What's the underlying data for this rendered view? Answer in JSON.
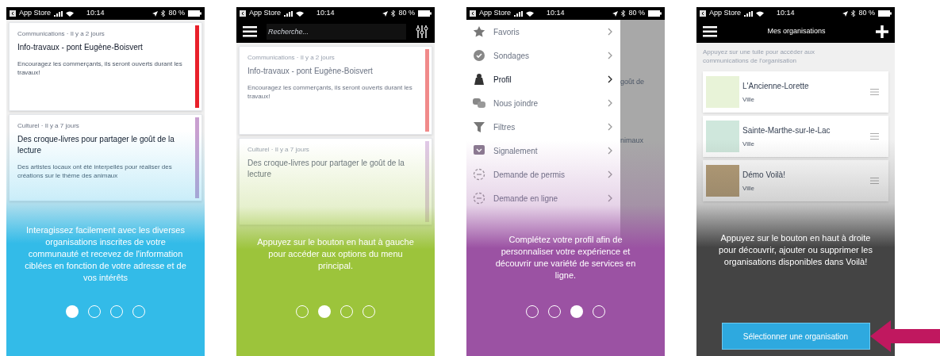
{
  "screens": [
    {
      "kind": "feed",
      "color": "#33bbe8",
      "status_bar": {
        "carrier": "App Store",
        "time": "10:14",
        "battery": "80 %"
      },
      "cards": [
        {
          "category": "Communications · Il y a 2 jours",
          "title": "Info-travaux - pont Eugène-Boisvert",
          "excerpt": "Encouragez les commerçants, ils seront ouverts durant les travaux!",
          "color": "#e8202a"
        },
        {
          "category": "Culturel · Il y a 7 jours",
          "title": "Des croque-livres pour partager le goût de la lecture",
          "excerpt": "Des artistes locaux ont été interpellés pour réaliser des créations sur le thème des animaux",
          "color": "#c9a0d0"
        }
      ],
      "message": "Interagissez facilement avec les diverses organisations inscrites de votre communauté et recevez de l'information ciblées en fonction de votre adresse et de vos intérêts",
      "pager": [
        {
          "selected": true
        },
        {
          "selected": false
        },
        {
          "selected": false
        },
        {
          "selected": false
        }
      ]
    },
    {
      "kind": "search",
      "color": "#9cc43b",
      "status_bar": {
        "carrier": "App Store",
        "time": "10:14",
        "battery": "80 %"
      },
      "search": {
        "placeholder": "Recherche..."
      },
      "cards": [
        {
          "category": "Communications · Il y a 2 jours",
          "title": "Info-travaux - pont Eugène-Boisvert",
          "excerpt": "Encouragez les commerçants, ils seront ouverts durant les travaux!",
          "color": "#f08a8a"
        },
        {
          "category": "Culturel · Il y a 7 jours",
          "title": "Des croque-livres pour partager le goût de la lecture",
          "color": "#e0c8e6"
        }
      ],
      "message": "Appuyez sur le bouton en haut à gauche pour accéder aux options du menu principal.",
      "pager": [
        {
          "selected": false
        },
        {
          "selected": true
        },
        {
          "selected": false
        },
        {
          "selected": false
        }
      ]
    },
    {
      "kind": "menu",
      "color": "#9b52a3",
      "status_bar": {
        "carrier": "App Store",
        "time": "10:14",
        "battery": "80 %"
      },
      "menu": [
        {
          "label": "Favoris",
          "kind": "star",
          "selected": false
        },
        {
          "label": "Sondages",
          "kind": "badge",
          "selected": false
        },
        {
          "label": "Profil",
          "kind": "person",
          "selected": true
        },
        {
          "label": "Nous joindre",
          "kind": "chat",
          "selected": false
        },
        {
          "label": "Filtres",
          "kind": "funnel",
          "selected": false
        },
        {
          "label": "Signalement",
          "kind": "report",
          "selected": false
        },
        {
          "label": "Demande de permis",
          "kind": "permit",
          "selected": false
        },
        {
          "label": "Demande en ligne",
          "kind": "permit",
          "selected": false
        }
      ],
      "behind": [
        "goût de",
        "nimaux"
      ],
      "message": "Complétez votre profil afin de personnaliser votre expérience et découvrir une variété de services en ligne.",
      "pager": [
        {
          "selected": false
        },
        {
          "selected": false
        },
        {
          "selected": true
        },
        {
          "selected": false
        }
      ]
    },
    {
      "kind": "organizations",
      "color": "#444444",
      "status_bar": {
        "carrier": "App Store",
        "time": "10:14",
        "battery": "80 %"
      },
      "title": "Mes organisations",
      "hint": "Appuyez sur une tuile pour accéder aux communications de l'organisation",
      "organizations": [
        {
          "name": "L'Ancienne-Lorette",
          "type": "Ville"
        },
        {
          "name": "Sainte-Marthe-sur-le-Lac",
          "type": "Ville"
        },
        {
          "name": "Démo Voilà!",
          "type": "Ville"
        }
      ],
      "message": "Appuyez sur le bouton en haut à droite pour découvrir, ajouter ou supprimer les organisations disponibles dans Voilà!",
      "button": "Sélectionner une organisation"
    }
  ]
}
